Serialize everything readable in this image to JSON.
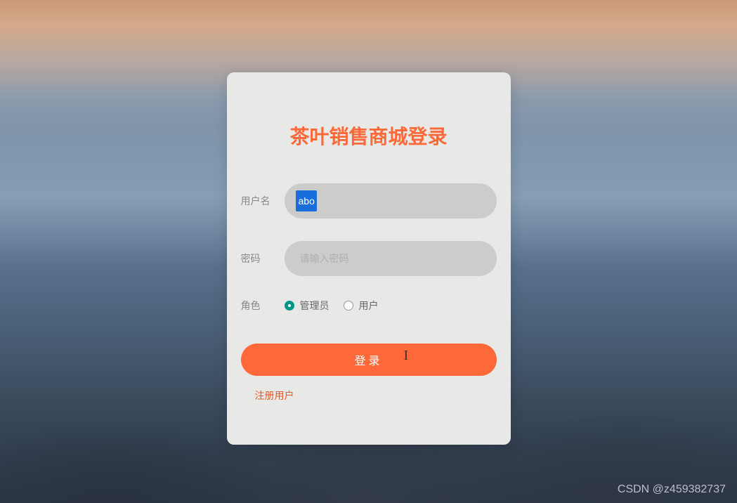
{
  "title": "茶叶销售商城登录",
  "form": {
    "username": {
      "label": "用户名",
      "value": "abo"
    },
    "password": {
      "label": "密码",
      "placeholder": "请输入密码"
    },
    "role": {
      "label": "角色",
      "options": [
        {
          "label": "管理员",
          "checked": true
        },
        {
          "label": "用户",
          "checked": false
        }
      ]
    }
  },
  "buttons": {
    "login": "登录"
  },
  "links": {
    "register": "注册用户"
  },
  "watermark": "CSDN @z459382737"
}
